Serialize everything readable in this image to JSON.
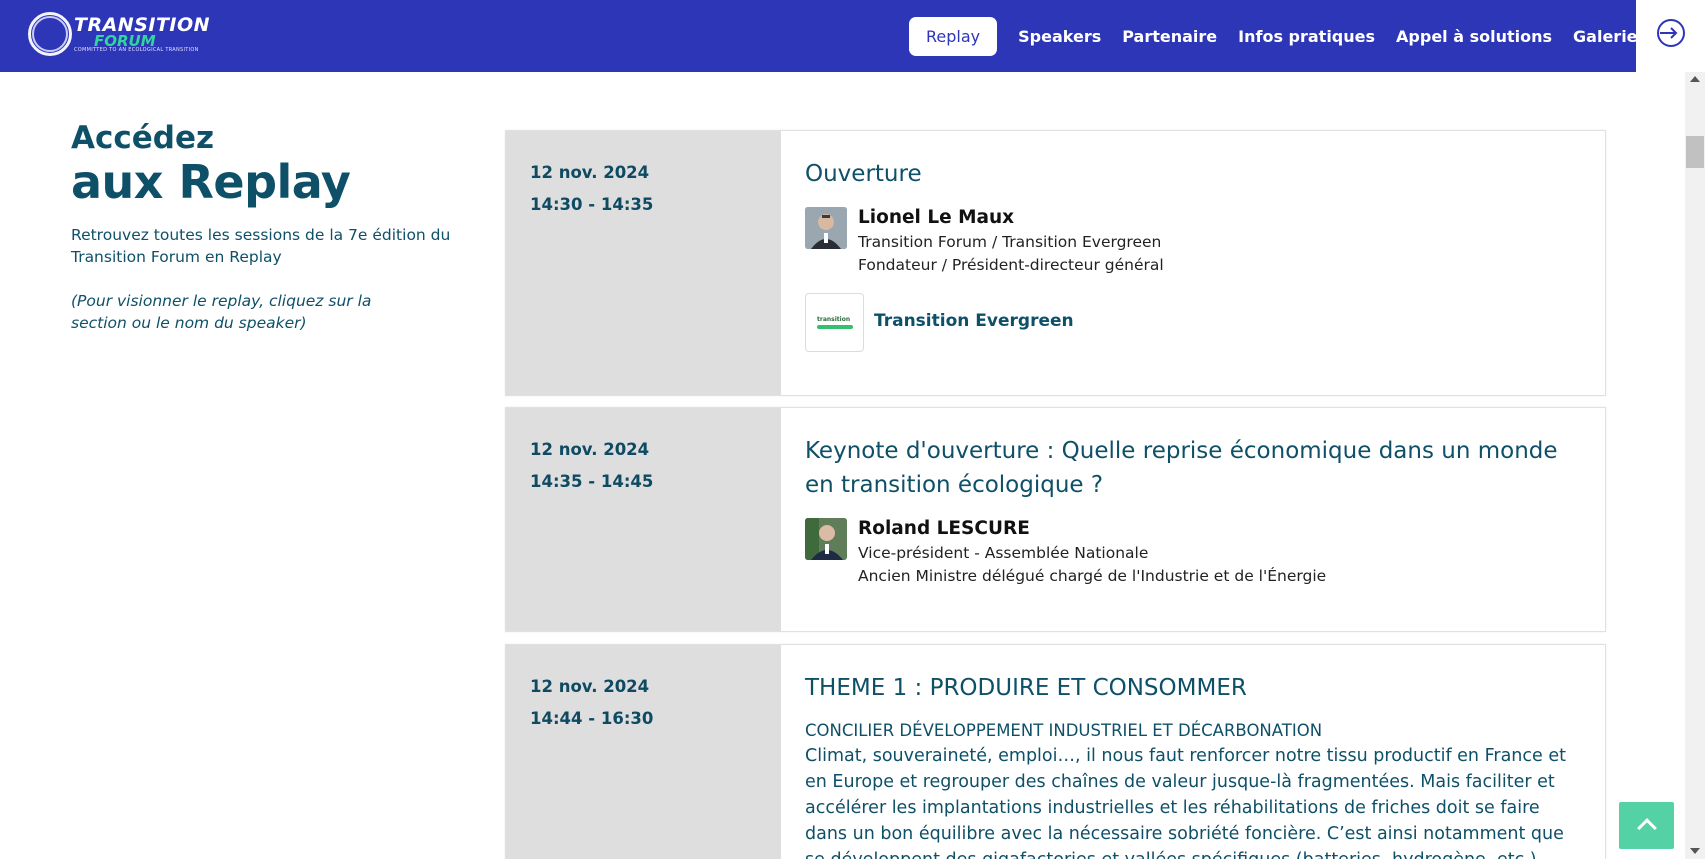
{
  "header": {
    "logo_title": "TRANSITION",
    "logo_subtitle": "FORUM",
    "logo_tagline": "COMMITTED TO AN ECOLOGICAL TRANSITION",
    "nav": [
      {
        "label": "Replay",
        "active": true
      },
      {
        "label": "Speakers"
      },
      {
        "label": "Partenaire"
      },
      {
        "label": "Infos pratiques"
      },
      {
        "label": "Appel à solutions"
      },
      {
        "label": "Galerie"
      }
    ],
    "login_icon": "login-icon",
    "bg_color": "#2e36b8"
  },
  "intro": {
    "title_line1": "Accédez",
    "title_line2": "aux Replay",
    "text": "Retrouvez toutes les sessions de la 7e édition du Transition Forum en Replay",
    "note": "(Pour visionner le replay, cliquez sur la section ou le nom du speaker)"
  },
  "sessions": [
    {
      "date": "12 nov. 2024",
      "time": "14:30 - 14:35",
      "title": "Ouverture",
      "speaker": {
        "name": "Lionel Le Maux",
        "line1": "Transition Forum / Transition Evergreen",
        "line2": "Fondateur / Président-directeur général"
      },
      "partner": "Transition Evergreen",
      "partner_logo_text": "transition"
    },
    {
      "date": "12 nov. 2024",
      "time": "14:35 - 14:45",
      "title": "Keynote d'ouverture : Quelle reprise économique dans un monde en transition écologique ?",
      "speaker": {
        "name": "Roland LESCURE",
        "line1": "Vice-président - Assemblée Nationale",
        "line2": "Ancien Ministre délégué chargé de l'Industrie et de l'Énergie"
      }
    },
    {
      "date": "12 nov. 2024",
      "time": "14:44 - 16:30",
      "title": "THEME 1 : PRODUIRE ET CONSOMMER",
      "subtitle": "CONCILIER DÉVELOPPEMENT INDUSTRIEL ET DÉCARBONATION",
      "body": "Climat, souveraineté, emploi…, il nous faut renforcer notre tissu productif en France et en Europe et regrouper des chaînes de valeur jusque-là fragmentées. Mais faciliter et accélérer les implantations industrielles et les réhabilitations de friches doit se faire dans un bon équilibre avec la nécessaire sobriété foncière. C’est ainsi notamment que se développent des gigafactories et vallées spécifiques (batteries, hydrogène, etc.)"
    }
  ],
  "back_to_top_color": "#54d1a5"
}
